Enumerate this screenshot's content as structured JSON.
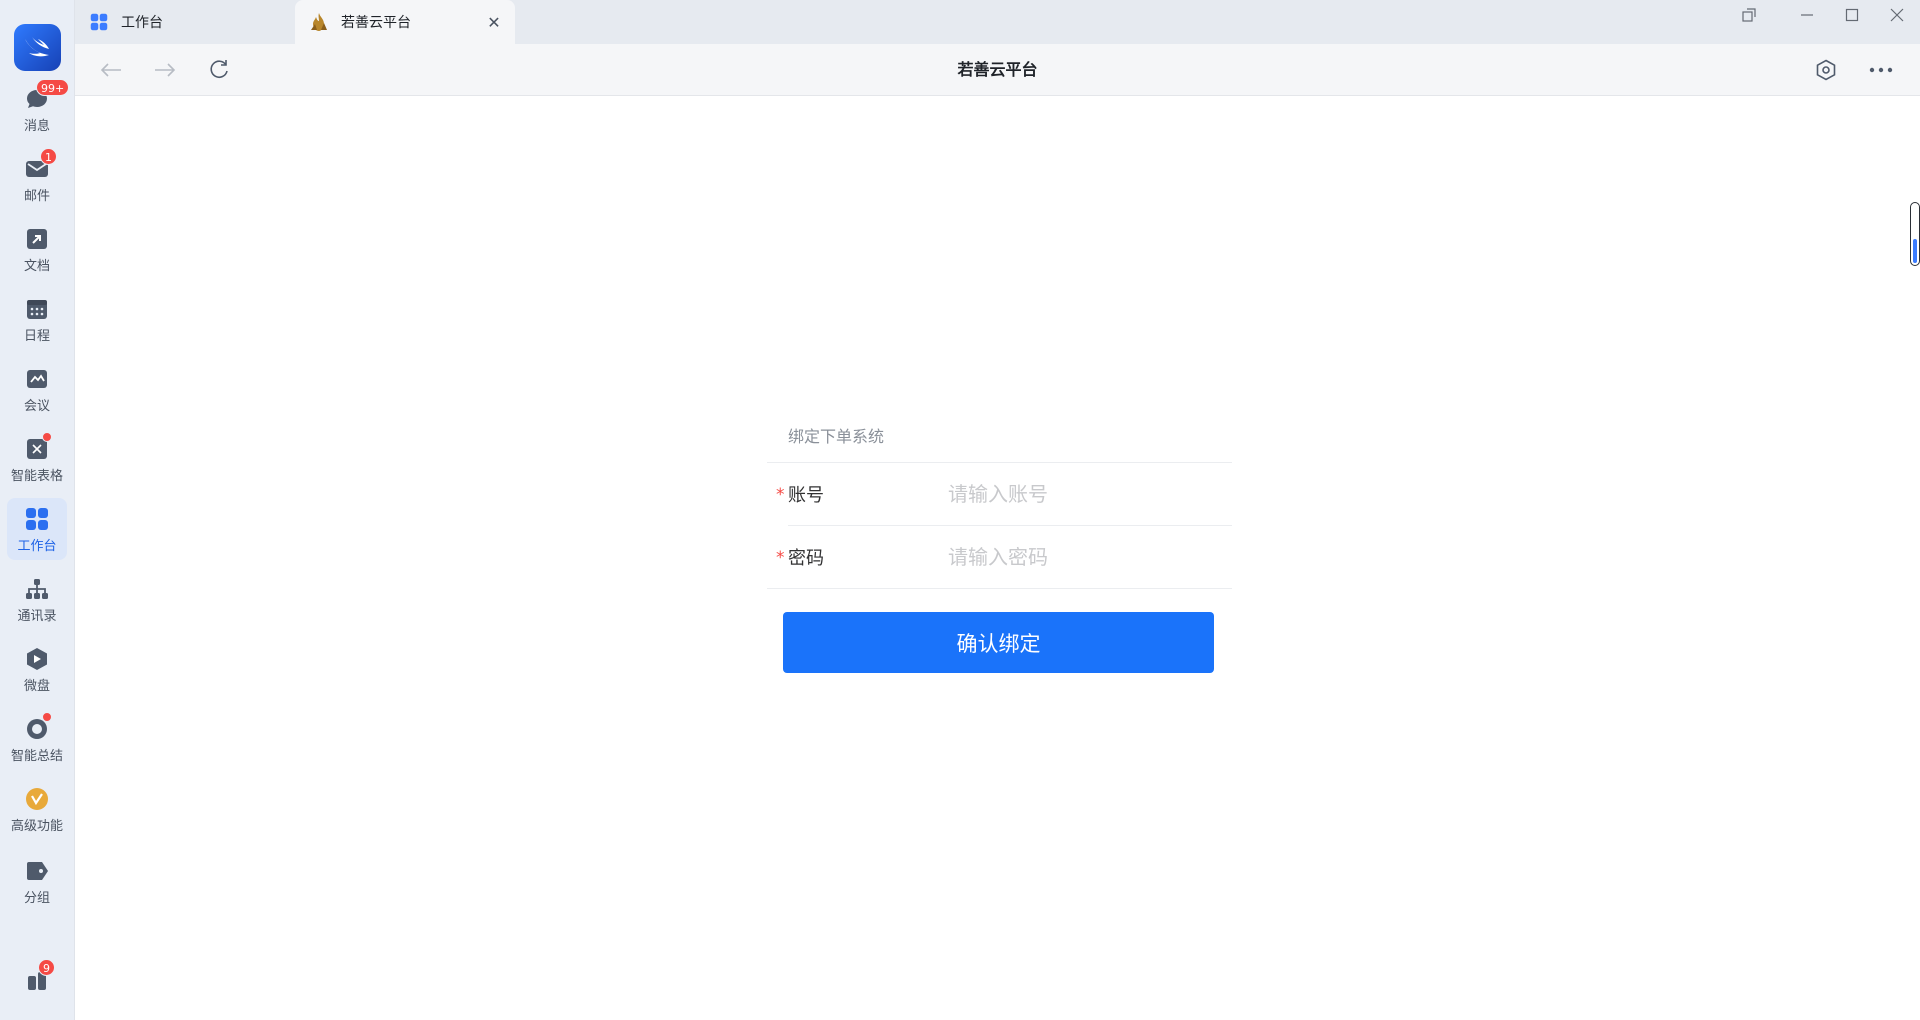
{
  "sidebar": {
    "items": [
      {
        "label": "消息",
        "icon": "chat-bubble-icon",
        "badge": "99+"
      },
      {
        "label": "邮件",
        "icon": "mail-icon",
        "badge": "1"
      },
      {
        "label": "文档",
        "icon": "document-icon"
      },
      {
        "label": "日程",
        "icon": "calendar-icon"
      },
      {
        "label": "会议",
        "icon": "meeting-icon"
      },
      {
        "label": "智能表格",
        "icon": "smart-sheet-icon"
      },
      {
        "label": "工作台",
        "icon": "workbench-grid-icon"
      },
      {
        "label": "通讯录",
        "icon": "org-chart-icon"
      },
      {
        "label": "微盘",
        "icon": "drive-icon"
      },
      {
        "label": "智能总结",
        "icon": "smart-summary-icon"
      },
      {
        "label": "高级功能",
        "icon": "premium-icon"
      },
      {
        "label": "分组",
        "icon": "tag-icon"
      }
    ],
    "bottom_badge": "9"
  },
  "tabs": [
    {
      "label": "工作台",
      "icon": "workbench-grid-icon"
    },
    {
      "label": "若善云平台",
      "icon": "app-flame-icon"
    }
  ],
  "toolbar": {
    "title": "若善云平台"
  },
  "form": {
    "title": "绑定下单系统",
    "required_mark": "*",
    "account_label": "账号",
    "account_placeholder": "请输入账号",
    "password_label": "密码",
    "password_placeholder": "请输入密码",
    "submit_label": "确认绑定"
  },
  "colors": {
    "primary": "#1a73fa",
    "badge": "#f54a45",
    "sidebar_bg": "#e9eef6"
  }
}
